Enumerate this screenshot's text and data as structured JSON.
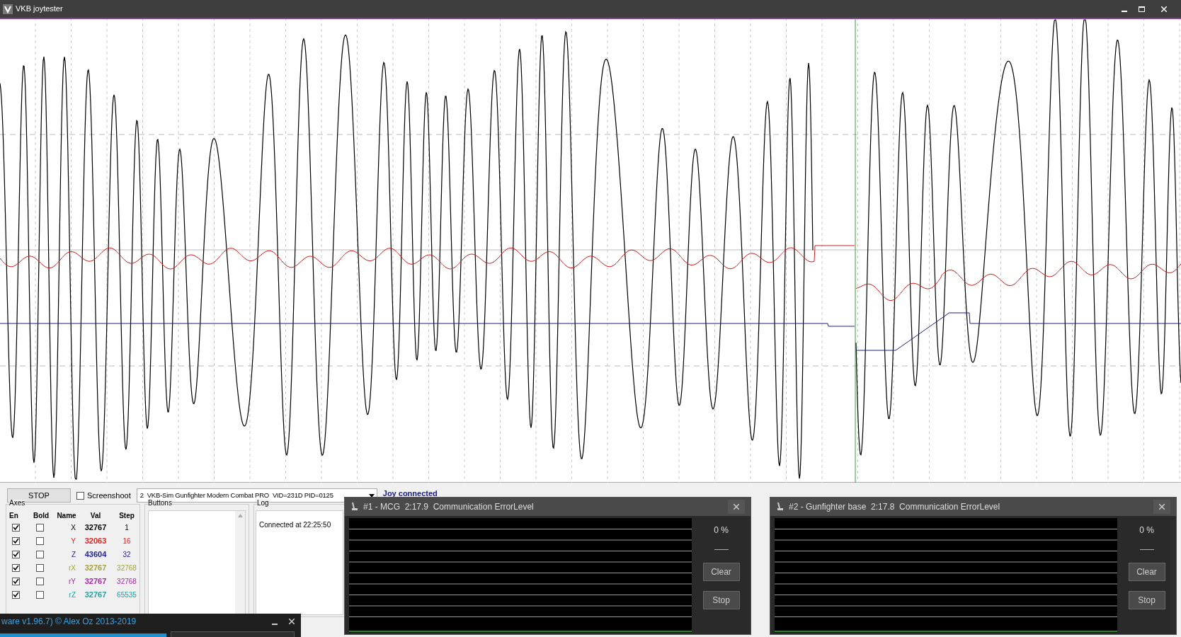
{
  "window": {
    "title": "VKB joytester"
  },
  "toolbar": {
    "stop_button": "STOP",
    "screenshot": {
      "label": "Screenshoot",
      "checked": false
    },
    "device": "2  VKB-Sim Gunfighter Modern Combat PRO  VID=231D PID=0125",
    "status": "Joy connected"
  },
  "axes": {
    "title": "Axes",
    "columns": [
      "En",
      "Bold",
      "Name",
      "Val",
      "Step"
    ],
    "rows": [
      {
        "enabled": true,
        "bold": false,
        "name": "X",
        "val": "32767",
        "step": "1",
        "color": "#000000"
      },
      {
        "enabled": true,
        "bold": false,
        "name": "Y",
        "val": "32063",
        "step": "16",
        "color": "#e02424"
      },
      {
        "enabled": true,
        "bold": false,
        "name": "Z",
        "val": "43604",
        "step": "32",
        "color": "#23238c"
      },
      {
        "enabled": true,
        "bold": false,
        "name": "rX",
        "val": "32767",
        "step": "32768",
        "color": "#a3a33a"
      },
      {
        "enabled": true,
        "bold": false,
        "name": "rY",
        "val": "32767",
        "step": "32768",
        "color": "#a52aa5"
      },
      {
        "enabled": true,
        "bold": false,
        "name": "rZ",
        "val": "32767",
        "step": "65535",
        "color": "#23a0a0"
      }
    ]
  },
  "buttons_panel": {
    "title": "Buttons"
  },
  "log": {
    "title": "Log",
    "lines": [
      "Connected at 22:25:50"
    ]
  },
  "error_windows": [
    {
      "title": "#1 - MCG  2:17.9  Communication ErrorLevel",
      "percent": "0 %",
      "buttons": [
        "Clear",
        "Stop"
      ]
    },
    {
      "title": "#2 - Gunfighter base  2:17.8  Communication ErrorLevel",
      "percent": "0 %",
      "buttons": [
        "Clear",
        "Stop"
      ]
    }
  ],
  "about_window": {
    "title": "ware v1.96.7) © Alex Oz 2013-2019"
  }
}
